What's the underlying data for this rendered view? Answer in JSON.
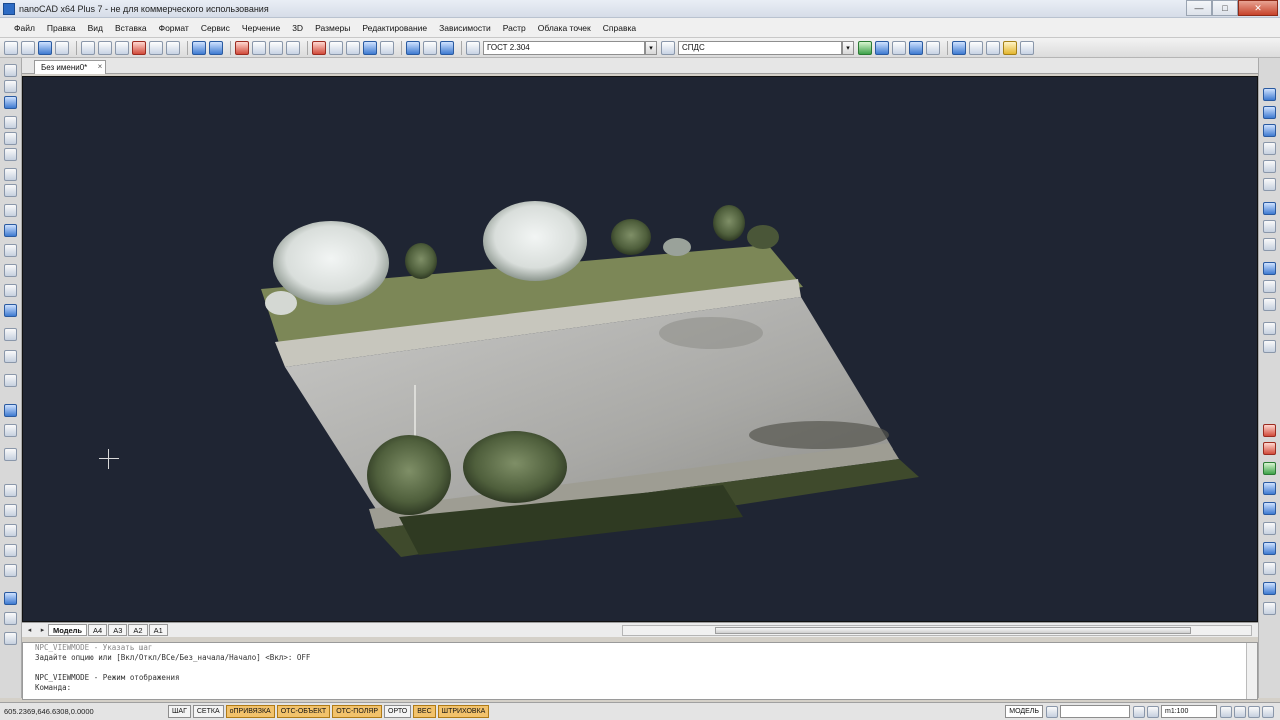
{
  "window": {
    "title": "nanoCAD x64 Plus 7 - не для коммерческого использования",
    "minimize_glyph": "—",
    "maximize_glyph": "□",
    "close_glyph": "✕"
  },
  "menu": [
    "Файл",
    "Правка",
    "Вид",
    "Вставка",
    "Формат",
    "Сервис",
    "Черчение",
    "3D",
    "Размеры",
    "Редактирование",
    "Зависимости",
    "Растр",
    "Облака точек",
    "Справка"
  ],
  "toolbar": {
    "standard_field": "ГОСТ 2.304",
    "style_field": "СПДС",
    "dropdown_glyph": "▾"
  },
  "document": {
    "tab_label": "Без имени0*",
    "close_glyph": "×"
  },
  "layouts": {
    "prev_glyph": "◂",
    "next_glyph": "▸",
    "tabs": [
      "Модель",
      "A4",
      "A3",
      "A2",
      "A1"
    ],
    "active": "Модель"
  },
  "command": {
    "lines": [
      "NPC_VIEWMODE - Указать шаг",
      "Задайте опцию или [Вкл/Откл/ВСе/Без_начала/Начало] <Вкл>: OFF",
      "",
      "NPC_VIEWMODE - Режим отображения",
      "Команда:"
    ]
  },
  "status": {
    "coordinates": "605.2369,646.6308,0.0000",
    "buttons": [
      {
        "label": "ШАГ",
        "on": false
      },
      {
        "label": "СЕТКА",
        "on": false
      },
      {
        "label": "оПРИВЯЗКА",
        "on": true
      },
      {
        "label": "ОТС-ОБЪЕКТ",
        "on": true
      },
      {
        "label": "ОТС-ПОЛЯР",
        "on": true
      },
      {
        "label": "ОРТО",
        "on": false
      },
      {
        "label": "ВЕС",
        "on": true
      },
      {
        "label": "ШТРИХОВКА",
        "on": true
      }
    ],
    "model_label": "МОДЕЛЬ",
    "scale": "m1:100"
  },
  "colors": {
    "viewport_bg": "#1f2533",
    "status_on": "#f2c26b"
  }
}
